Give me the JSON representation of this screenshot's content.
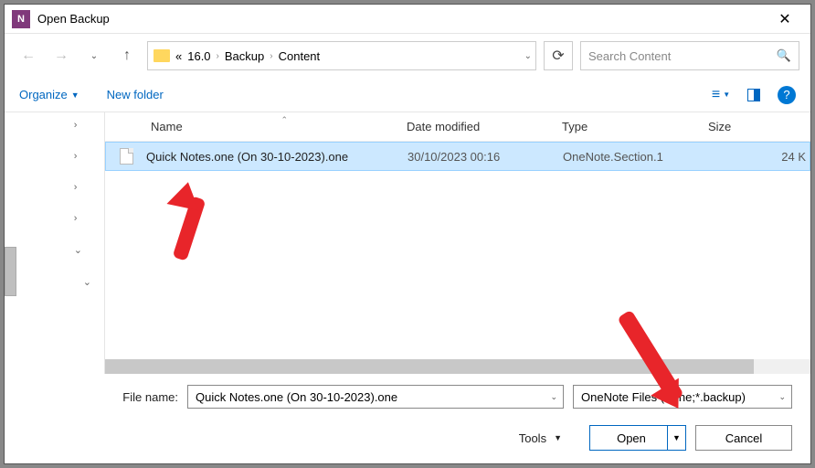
{
  "window": {
    "title": "Open Backup"
  },
  "breadcrumb": {
    "prefix": "«",
    "parts": [
      "16.0",
      "Backup",
      "Content"
    ]
  },
  "search": {
    "placeholder": "Search Content"
  },
  "toolbar": {
    "organize": "Organize",
    "new_folder": "New folder"
  },
  "columns": {
    "name": "Name",
    "date": "Date modified",
    "type": "Type",
    "size": "Size"
  },
  "file": {
    "name": "Quick Notes.one (On 30-10-2023).one",
    "date": "30/10/2023 00:16",
    "type": "OneNote.Section.1",
    "size": "24 K"
  },
  "footer": {
    "file_name_label": "File name:",
    "file_name_value": "Quick Notes.one (On 30-10-2023).one",
    "filter": "OneNote Files (*.one;*.backup)",
    "tools": "Tools",
    "open": "Open",
    "cancel": "Cancel"
  }
}
